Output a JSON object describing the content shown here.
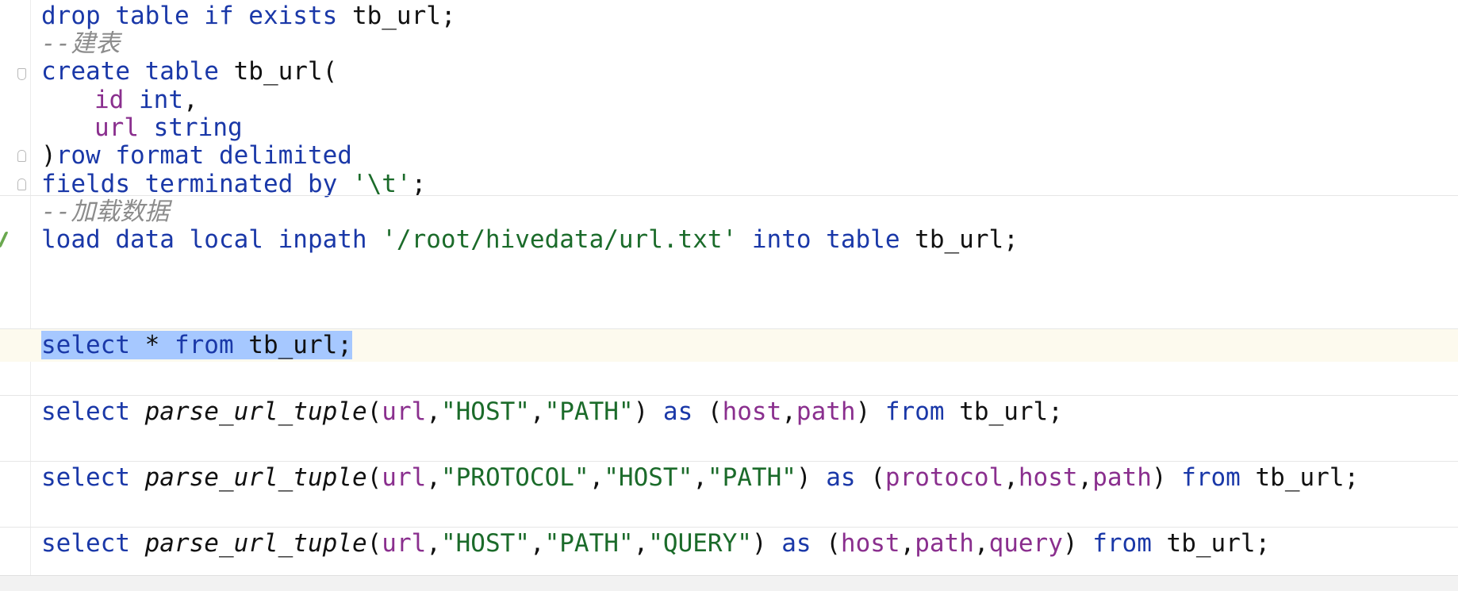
{
  "editor": {
    "lines": {
      "l1": {
        "t1": "drop table if exists",
        "t2": " tb_url;"
      },
      "l2": {
        "t1": "--建表"
      },
      "l3": {
        "t1": "create table",
        "t2": " tb_url("
      },
      "l4": {
        "t1": "id",
        "t2": " int",
        "t3": ","
      },
      "l5": {
        "t1": "url",
        "t2": " string"
      },
      "l6": {
        "t1": ")",
        "t2": "row format delimited"
      },
      "l7": {
        "t1": "fields terminated by",
        "t2": " '\\t'",
        "t3": ";"
      },
      "l8": {
        "t1": "--加载数据"
      },
      "l9": {
        "t1": "load data local inpath",
        "t2": " '/root/hivedata/url.txt'",
        "t3": " into table",
        "t4": " tb_url;"
      },
      "l11": {
        "t1": "select",
        "t2": " * ",
        "t3": "from",
        "t4": " tb_url;"
      },
      "l13": {
        "t1": "select",
        "t2": " parse_url_tuple",
        "t3": "(",
        "t4": "url",
        "t5": ",",
        "t6": "\"HOST\"",
        "t7": ",",
        "t8": "\"PATH\"",
        "t9": ") ",
        "t10": "as",
        "t11": " (",
        "t12": "host",
        "t13": ",",
        "t14": "path",
        "t15": ") ",
        "t16": "from",
        "t17": " tb_url;"
      },
      "l15": {
        "t1": "select",
        "t2": " parse_url_tuple",
        "t3": "(",
        "t4": "url",
        "t5": ",",
        "t6": "\"PROTOCOL\"",
        "t7": ",",
        "t8": "\"HOST\"",
        "t9": ",",
        "t10": "\"PATH\"",
        "t11": ") ",
        "t12": "as",
        "t13": " (",
        "t14": "protocol",
        "t15": ",",
        "t16": "host",
        "t17": ",",
        "t18": "path",
        "t19": ") ",
        "t20": "from",
        "t21": " tb_url;"
      },
      "l17": {
        "t1": "select",
        "t2": " parse_url_tuple",
        "t3": "(",
        "t4": "url",
        "t5": ",",
        "t6": "\"HOST\"",
        "t7": ",",
        "t8": "\"PATH\"",
        "t9": ",",
        "t10": "\"QUERY\"",
        "t11": ") ",
        "t12": "as",
        "t13": " (",
        "t14": "host",
        "t15": ",",
        "t16": "path",
        "t17": ",",
        "t18": "query",
        "t19": ") ",
        "t20": "from",
        "t21": " tb_url;"
      }
    },
    "colors": {
      "keyword": "#1a38a8",
      "string": "#1b6b2a",
      "column": "#8a2f8e",
      "comment": "#8c8c8c",
      "selection": "#a6c8ff",
      "current_line": "#fdfaee"
    }
  }
}
